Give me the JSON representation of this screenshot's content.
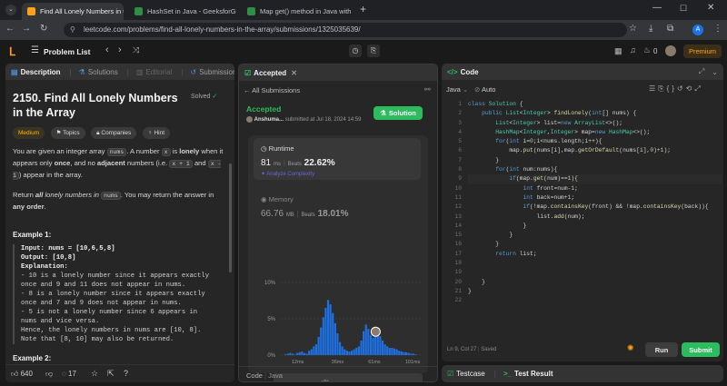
{
  "browser": {
    "tabs": [
      {
        "label": "Find All Lonely Numbers in the",
        "active": true
      },
      {
        "label": "HashSet in Java - GeeksforGeek",
        "active": false
      },
      {
        "label": "Map get() method in Java with",
        "active": false
      }
    ],
    "new_tab": "+",
    "url": "leetcode.com/problems/find-all-lonely-numbers-in-the-array/submissions/1325035639/"
  },
  "header": {
    "problem_list": "Problem List",
    "streak": "0",
    "premium": "Premium"
  },
  "left": {
    "tabs": [
      "Description",
      "Solutions",
      "Editorial",
      "Submissions"
    ],
    "title": "2150. Find All Lonely Numbers in the Array",
    "solved": "Solved",
    "tags": [
      "Medium",
      "Topics",
      "Companies",
      "Hint"
    ],
    "p1_a": "You are given an integer array",
    "p1_nums": "nums",
    "p1_b": ". A number",
    "p1_x": "x",
    "p1_c": "is",
    "p1_lonely": "lonely",
    "p1_d": "when it appears only",
    "p1_once": "once",
    "p1_e": ", and no",
    "p1_adjacent": "adjacent",
    "p1_f": "numbers (i.e.",
    "p1_x1": "x + 1",
    "p1_and": "and",
    "p1_x2": "x - 1",
    "p1_g": ") appear in the array.",
    "p2_a": "Return",
    "p2_all": "all",
    "p2_lonely": "lonely numbers in",
    "p2_nums": "nums",
    "p2_b": ". You may return the answer in",
    "p2_any": "any order",
    "p2_c": ".",
    "example1_title": "Example 1:",
    "example1_lines": [
      "Input: nums = [10,6,5,8]",
      "Output: [10,8]",
      "Explanation:",
      "- 10 is a lonely number since it appears exactly",
      "once and 9 and 11 does not appear in nums.",
      "- 8 is a lonely number since it appears exactly",
      "once and 7 and 9 does not appear in nums.",
      "- 5 is not a lonely number since 6 appears in",
      "nums and vice versa.",
      "Hence, the lonely numbers in nums are [10, 8].",
      "Note that [8, 10] may also be returned."
    ],
    "example2_title": "Example 2:",
    "likes": "640",
    "comments": "17"
  },
  "middle": {
    "tab": "Accepted",
    "back": "All Submissions",
    "status": "Accepted",
    "user": "Anshuma...",
    "submitted": "submitted at Jul 18, 2024 14:59",
    "solution_btn": "Solution",
    "runtime_label": "Runtime",
    "runtime_value": "81",
    "runtime_unit": "ms",
    "beats_label": "Beats",
    "runtime_beats": "22.62%",
    "analyze": "Analyze Complexity",
    "memory_label": "Memory",
    "memory_value": "66.76",
    "memory_unit": "MB",
    "memory_beats": "18.01%",
    "footer_code": "Code",
    "footer_lang": "Java"
  },
  "chart_data": {
    "type": "bar",
    "title": "",
    "xlabel": "",
    "ylabel": "",
    "ylim": [
      0,
      10
    ],
    "y_ticks": [
      "10%",
      "5%",
      "0%"
    ],
    "x_ticks": [
      "12ms",
      "36ms",
      "61ms",
      "101ms"
    ],
    "mini_ticks": [
      "12ms",
      "36ms",
      "61ms",
      "101ms"
    ],
    "bars": [
      0.1,
      0.2,
      0.3,
      0.2,
      0.1,
      0.3,
      0.4,
      0.5,
      0.3,
      0.2,
      0.6,
      0.8,
      1.2,
      1.5,
      2.5,
      3.8,
      5.2,
      6.5,
      7.6,
      7.0,
      5.8,
      4.4,
      3.0,
      1.8,
      1.2,
      0.8,
      0.6,
      0.5,
      0.6,
      0.8,
      1.0,
      1.2,
      2.0,
      3.3,
      4.2,
      3.6,
      2.8,
      2.4,
      2.6,
      3.0,
      2.6,
      2.0,
      1.5,
      1.2,
      1.0,
      1.0,
      0.9,
      0.8,
      0.6,
      0.5,
      0.4,
      0.4,
      0.3,
      0.2,
      0.2,
      0.1
    ],
    "highlight_index": 38,
    "color": "#1e6fe0"
  },
  "editor": {
    "tab": "Code",
    "lang": "Java",
    "auto": "Auto",
    "lines": [
      "class Solution {",
      "    public List<Integer> findLonely(int[] nums) {",
      "        List<Integer> list=new ArrayList<>();",
      "        HashMap<Integer,Integer> map=new HashMap<>();",
      "        for(int i=0;i<nums.length;i++){",
      "            map.put(nums[i],map.getOrDefault(nums[i],0)+1);",
      "        }",
      "        for(int num:nums){",
      "            if(map.get(num)==1){",
      "                int front=num-1;",
      "                int back=num+1;",
      "                if(!map.containsKey(front) && !map.containsKey(back)){",
      "                    list.add(num);",
      "                }",
      "            }",
      "        }",
      "        return list;",
      "",
      "",
      "    }",
      "}"
    ],
    "line_numbers": [
      "1",
      "2",
      "3",
      "4",
      "5",
      "6",
      "7",
      "8",
      "9",
      "10",
      "11",
      "12",
      "13",
      "14",
      "15",
      "16",
      "17",
      "18",
      "19",
      "20",
      "21",
      "22"
    ],
    "status": "Ln 9, Col 27",
    "saved": "Saved",
    "run": "Run",
    "submit": "Submit",
    "testcase": "Testcase",
    "test_result": "Test Result"
  }
}
